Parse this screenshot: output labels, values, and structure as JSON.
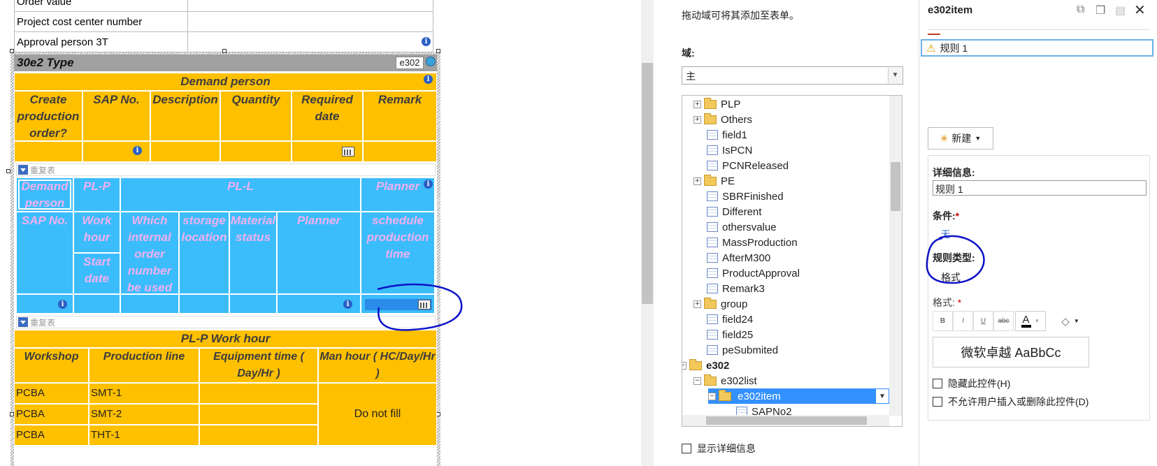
{
  "form": {
    "top_rows": [
      {
        "label": "Order value"
      },
      {
        "label": "Project cost center number"
      },
      {
        "label": "Approval person 3T"
      }
    ],
    "section_title": "30e2 Type",
    "section_tag": "e302",
    "demand": {
      "title": "Demand person",
      "headers": [
        "Create production order?",
        "SAP No.",
        "Description",
        "Quantity",
        "Required date",
        "Remark"
      ]
    },
    "repeat_label": "重复表",
    "pl": {
      "demand_person": "Demand person",
      "pl_p": "PL-P",
      "pl_l": "PL-L",
      "planner_top": "Planner",
      "sap_no": "SAP No.",
      "work_hour": "Work hour",
      "start_date": "Start date",
      "which_internal": "Which internal order number be used",
      "storage": "storage location",
      "material_status": "Material status",
      "planner": "Planner",
      "schedule": "schedule production time"
    },
    "workhour": {
      "title": "PL-P Work hour",
      "headers": [
        "Workshop",
        "Production line",
        "Equipment time ( Day/Hr )",
        "Man hour ( HC/Day/Hr )"
      ],
      "rows": [
        {
          "workshop": "PCBA",
          "line": "SMT-1"
        },
        {
          "workshop": "PCBA",
          "line": "SMT-2"
        },
        {
          "workshop": "PCBA",
          "line": "THT-1"
        }
      ],
      "merged_note": "Do not fill"
    }
  },
  "fields_pane": {
    "hint": "拖动域可将其添加至表单。",
    "domain_label": "域:",
    "domain_value": "主",
    "tree": [
      {
        "label": "PLP",
        "kind": "folder",
        "expander": "+",
        "indent": 0
      },
      {
        "label": "Others",
        "kind": "folder",
        "expander": "+",
        "indent": 0
      },
      {
        "label": "field1",
        "kind": "field",
        "indent": 0
      },
      {
        "label": "IsPCN",
        "kind": "field",
        "indent": 0
      },
      {
        "label": "PCNReleased",
        "kind": "field",
        "indent": 0
      },
      {
        "label": "PE",
        "kind": "folder",
        "expander": "+",
        "indent": 0
      },
      {
        "label": "SBRFinished",
        "kind": "field",
        "indent": 0
      },
      {
        "label": "Different",
        "kind": "field",
        "indent": 0
      },
      {
        "label": "othersvalue",
        "kind": "field",
        "indent": 0
      },
      {
        "label": "MassProduction",
        "kind": "field",
        "indent": 0
      },
      {
        "label": "AfterM300",
        "kind": "field",
        "indent": 0
      },
      {
        "label": "ProductApproval",
        "kind": "field",
        "indent": 0
      },
      {
        "label": "Remark3",
        "kind": "field",
        "indent": 0
      },
      {
        "label": "group",
        "kind": "folder",
        "expander": "+",
        "indent": 0
      },
      {
        "label": "field24",
        "kind": "field",
        "indent": 0
      },
      {
        "label": "field25",
        "kind": "field",
        "indent": 0
      },
      {
        "label": "peSubmited",
        "kind": "field",
        "indent": 0
      },
      {
        "label": "e302",
        "kind": "folder",
        "expander": "−",
        "indent": -1,
        "bold": true
      },
      {
        "label": "e302list",
        "kind": "folder",
        "expander": "−",
        "indent": 0
      },
      {
        "label": "e302item",
        "kind": "folder",
        "expander": "−",
        "indent": 1,
        "selected": true
      },
      {
        "label": "SAPNo2",
        "kind": "field",
        "indent": 2
      }
    ],
    "show_details": "显示详细信息"
  },
  "rules_pane": {
    "title": "e302item",
    "rule_item": "规则 1",
    "new_button": "新建",
    "details_label": "详细信息:",
    "details_value": "规则 1",
    "condition_label": "条件:",
    "condition_value": "无",
    "rule_type_label": "规则类型:",
    "rule_type_value": "格式",
    "format_label": "格式:",
    "required_mark": "*",
    "format_buttons": [
      "B",
      "I",
      "U",
      "abc"
    ],
    "preview_text": "微软卓越  AaBbCc",
    "hide_control": "隐藏此控件(H)",
    "disallow_insert": "不允许用户插入或删除此控件(D)"
  },
  "colors": {
    "yellow": "#ffc000",
    "blue": "#3cbdfb",
    "pink_text": "#f0b0f0",
    "ink_annotation": "#0b12c8",
    "selection": "#3390ff"
  }
}
